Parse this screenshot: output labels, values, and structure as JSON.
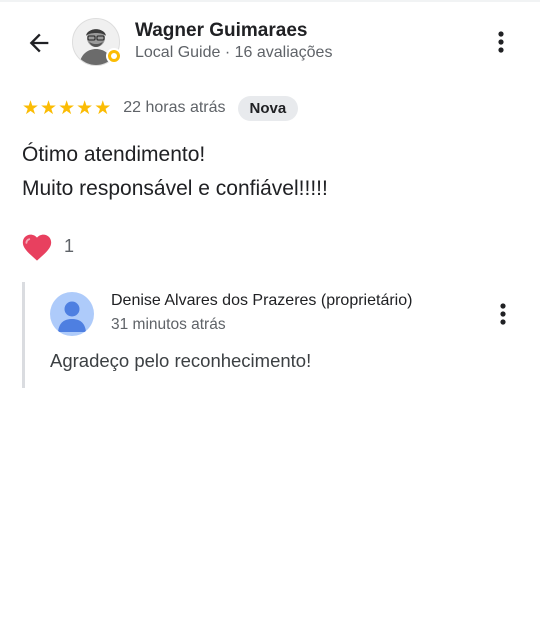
{
  "reviewer": {
    "name": "Wagner Guimaraes",
    "meta": "Local Guide · 16 avaliações"
  },
  "review": {
    "rating": 5,
    "rating_max": 5,
    "time": "22 horas atrás",
    "badge": "Nova",
    "lines": [
      "Ótimo atendimento!",
      "Muito responsável e confiável!!!!!"
    ],
    "likes": "1"
  },
  "reply": {
    "owner": "Denise Alvares dos Prazeres (proprietário)",
    "time": "31 minutos atrás",
    "text": "Agradeço pelo reconhecimento!"
  },
  "colors": {
    "star": "#fbbc04",
    "heart": "#e8405f",
    "badge_bg": "#e8eaed",
    "owner_avatar": "#aecbfa",
    "owner_avatar_figure": "#4e7fe1"
  },
  "icons": {
    "back": "arrow-back-icon",
    "more": "more-vert-icon",
    "like": "heart-icon",
    "guide": "local-guide-badge-icon"
  }
}
